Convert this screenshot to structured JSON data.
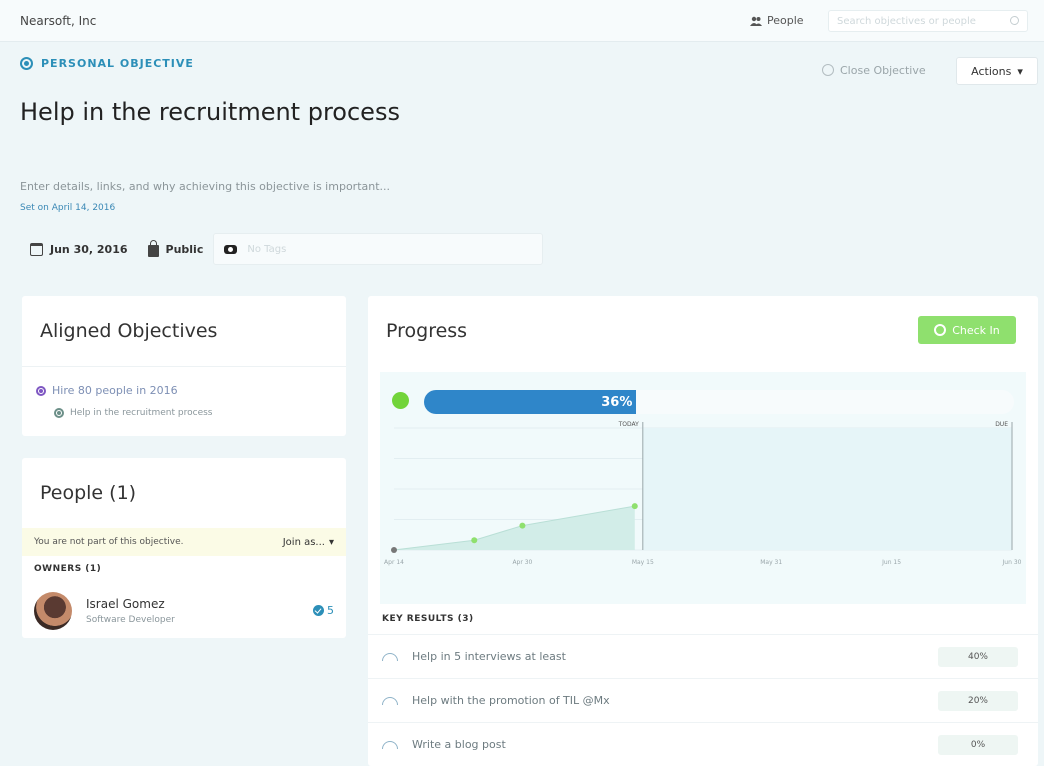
{
  "topbar": {
    "company": "Nearsoft, Inc",
    "people_link": "People",
    "search_placeholder": "Search objectives or people"
  },
  "header": {
    "type_label": "PERSONAL OBJECTIVE",
    "close_button": "Close Objective",
    "actions_button": "Actions",
    "title": "Help in the recruitment process",
    "description_placeholder": "Enter details, links, and why achieving this objective is important...",
    "set_on": "Set on April 14, 2016",
    "due_date": "Jun 30, 2016",
    "visibility": "Public",
    "tags_placeholder": "No Tags"
  },
  "aligned": {
    "title": "Aligned Objectives",
    "parent": "Hire 80 people in 2016",
    "child": "Help in the recruitment process"
  },
  "people": {
    "title": "People (1)",
    "notice": "You are not part of this objective.",
    "join_button": "Join as...",
    "owners_label": "OWNERS (1)",
    "owners": [
      {
        "name": "Israel Gomez",
        "role": "Software Developer",
        "checkins": "5"
      }
    ]
  },
  "progress": {
    "title": "Progress",
    "checkin_button": "Check In",
    "percent_label": "36%",
    "percent_value": 0.36,
    "status_color": "#72d43a",
    "bar_color": "#2f86c9"
  },
  "chart_data": {
    "type": "line",
    "x_ticks": [
      "Apr 14",
      "Apr 30",
      "May 15",
      "May 31",
      "Jun 15",
      "Jun 30"
    ],
    "markers": [
      {
        "label": "TODAY",
        "x": "May 15"
      },
      {
        "label": "DUE",
        "x": "Jun 30"
      }
    ],
    "points": [
      {
        "x": "Apr 14",
        "y": 0
      },
      {
        "x": "Apr 24",
        "y": 8
      },
      {
        "x": "Apr 30",
        "y": 20
      },
      {
        "x": "May 14",
        "y": 36
      }
    ],
    "ylim": [
      0,
      100
    ],
    "point_color": "#8fe06e"
  },
  "key_results": {
    "label": "KEY RESULTS (3)",
    "items": [
      {
        "text": "Help in 5 interviews at least",
        "percent": "40%"
      },
      {
        "text": "Help with the promotion of TIL @Mx",
        "percent": "20%"
      },
      {
        "text": "Write a blog post",
        "percent": "0%"
      }
    ]
  }
}
